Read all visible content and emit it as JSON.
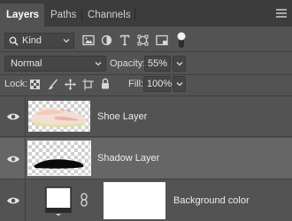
{
  "tabs": [
    {
      "label": "Layers",
      "active": true
    },
    {
      "label": "Paths",
      "active": false
    },
    {
      "label": "Channels",
      "active": false
    }
  ],
  "filter": {
    "kind_label": "Kind",
    "icons": [
      "image-filter-icon",
      "adjustment-filter-icon",
      "type-filter-icon",
      "shape-filter-icon",
      "smart-object-filter-icon",
      "filter-toggle-icon"
    ]
  },
  "blend": {
    "mode": "Normal",
    "opacity_label": "Opacity:",
    "opacity_value": "55%"
  },
  "lock": {
    "label": "Lock:",
    "icons": [
      "lock-transparent-pixels-icon",
      "lock-image-pixels-icon",
      "lock-position-icon",
      "lock-artboard-icon",
      "lock-all-icon"
    ],
    "fill_label": "Fill:",
    "fill_value": "100%"
  },
  "layers": [
    {
      "name": "Shoe Layer",
      "visible": true,
      "selected": false
    },
    {
      "name": "Shadow Layer",
      "visible": true,
      "selected": true
    },
    {
      "name": "Background color",
      "visible": true,
      "selected": false
    }
  ],
  "colors": {
    "panel_bg": "#535353",
    "tabbar_bg": "#3c3c3c",
    "selected_row": "#666666",
    "field_bg": "#454545"
  }
}
